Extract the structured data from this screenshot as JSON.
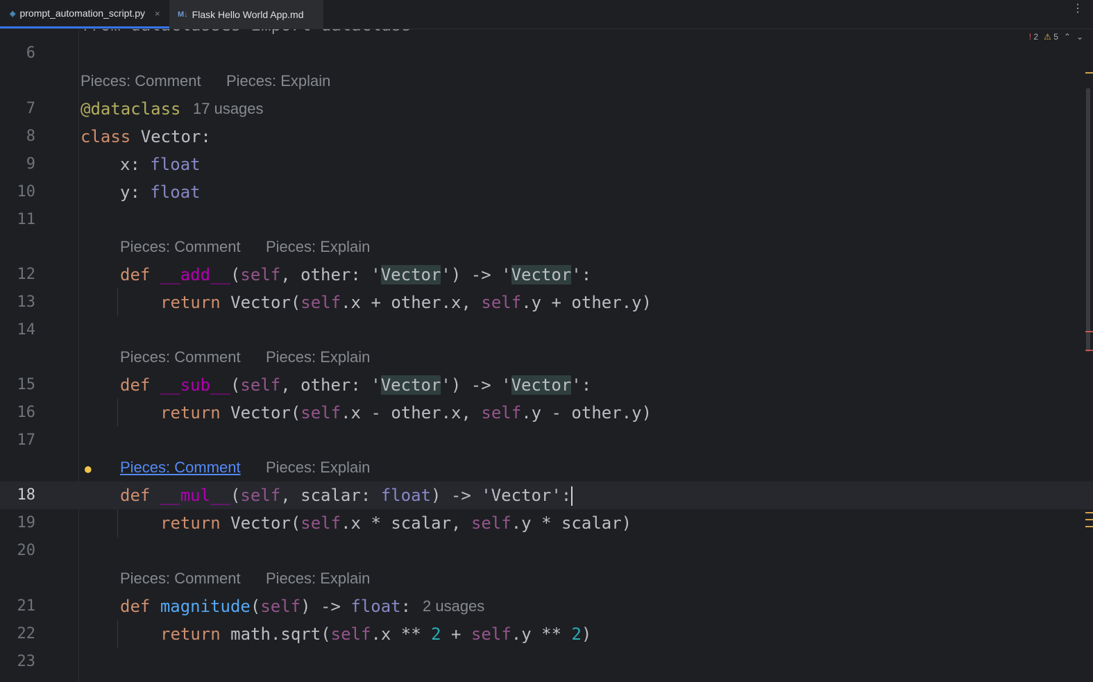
{
  "tabs": [
    {
      "label": "prompt_automation_script.py",
      "icon": "python-file-icon",
      "close": "×"
    },
    {
      "label": "Flask Hello World App.md",
      "icon": "markdown-file-icon",
      "icon_text": "M↓"
    }
  ],
  "menu_glyph": "⋮",
  "status": {
    "errors": "2",
    "warnings": "5",
    "error_glyph": "!",
    "warning_glyph": "⚠",
    "up_glyph": "⌃",
    "down_glyph": "⌄"
  },
  "top_partial": "from dataclasses import dataclass",
  "lines": {
    "l6": "6",
    "l7": "7",
    "l8": "8",
    "l9": "9",
    "l10": "10",
    "l11": "11",
    "l12": "12",
    "l13": "13",
    "l14": "14",
    "l15": "15",
    "l16": "16",
    "l17": "17",
    "l18": "18",
    "l19": "19",
    "l20": "20",
    "l21": "21",
    "l22": "22",
    "l23": "23"
  },
  "hints": {
    "comment": "Pieces: Comment",
    "explain": "Pieces: Explain",
    "usages_17": "17 usages",
    "usages_2": "2 usages"
  },
  "code": {
    "decorator": "@dataclass",
    "kw_class": "class",
    "class_name": " Vector:",
    "field_x": "x: ",
    "field_y": "y: ",
    "type_float": "float",
    "kw_def": "def",
    "kw_return": "return",
    "add": "__add__",
    "sub": "__sub__",
    "mul": "__mul__",
    "magnitude": "magnitude",
    "self": "self",
    "open_paren": "(",
    "sig_other_1": ", other: '",
    "vector_str": "Vector",
    "sig_other_2": "') -> '",
    "sig_end": "':",
    "ret_add_1": " Vector(",
    "ret_add_2": ".x + other.x, ",
    "ret_add_3": ".y + other.y)",
    "ret_sub_2": ".x - other.x, ",
    "ret_sub_3": ".y - other.y)",
    "sig_scalar": ", scalar: ",
    "sig_scalar_end": ") -> 'Vector':",
    "ret_mul_2": ".x * scalar, ",
    "ret_mul_3": ".y * scalar)",
    "mag_sig_1": ") -> ",
    "mag_sig_2": ":",
    "ret_mag_1": " math.sqrt(",
    "ret_mag_2": ".x ** ",
    "two": "2",
    "plus": " + ",
    "ret_mag_3": ".y ** ",
    "close_paren": ")"
  }
}
